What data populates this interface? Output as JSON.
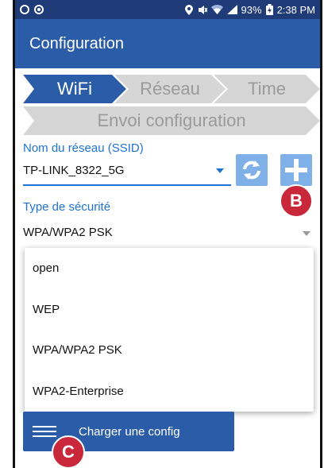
{
  "status_bar": {
    "battery": "93%",
    "time": "2:38 PM"
  },
  "app": {
    "title": "Configuration"
  },
  "steps": {
    "wifi": "WiFi",
    "reseau": "Réseau",
    "time": "Time",
    "envoi": "Envoi configuration"
  },
  "ssid": {
    "label": "Nom du réseau (SSID)",
    "value": "TP-LINK_8322_5G"
  },
  "security": {
    "label": "Type de sécurité",
    "value": "WPA/WPA2 PSK",
    "options": [
      "open",
      "WEP",
      "WPA/WPA2 PSK",
      "WPA2-Enterprise"
    ]
  },
  "annotations": {
    "b": "B",
    "c": "C"
  },
  "load_button": {
    "label": "Charger une config"
  },
  "colors": {
    "status_bar": "#1f3b78",
    "app_bar": "#2a5ca8",
    "accent": "#1e73d2",
    "badge": "#c8283a"
  },
  "icons": [
    "circle-icon",
    "location-icon",
    "mute-icon",
    "wifi-icon",
    "signal-icon",
    "battery-icon",
    "refresh-icon",
    "plus-icon",
    "menu-icon"
  ]
}
